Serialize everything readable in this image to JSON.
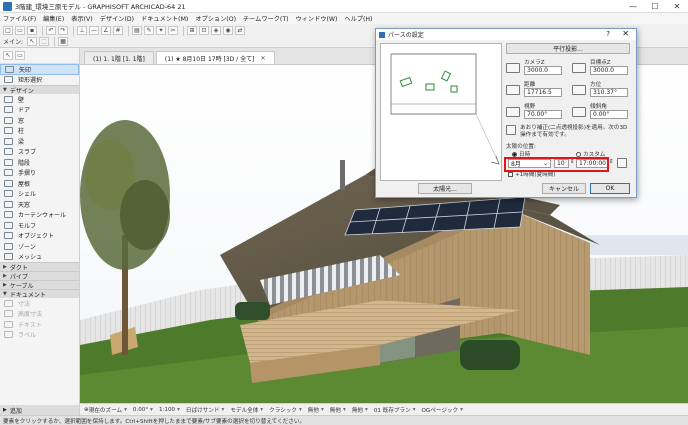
{
  "window": {
    "title": "3階建_環境三原モデル - GRAPHISOFT ARCHICAD-64 21",
    "controls": [
      "—",
      "☐",
      "✕"
    ]
  },
  "menu": [
    "ファイル(F)",
    "編集(E)",
    "表示(V)",
    "デザイン(D)",
    "ドキュメント(M)",
    "オプション(O)",
    "チームワーク(T)",
    "ウィンドウ(W)",
    "ヘルプ(H)"
  ],
  "toolbar": {
    "main_label": "メイン:"
  },
  "sidebar": {
    "tools": [
      {
        "label": "矢印",
        "selected": true
      },
      {
        "label": "矩形選択",
        "selected": false
      }
    ],
    "design_header": "デザイン",
    "design_items": [
      "壁",
      "ドア",
      "窓",
      "柱",
      "梁",
      "スラブ",
      "階段",
      "手摺り",
      "屋根",
      "シェル",
      "天窓",
      "カーテンウォール",
      "モルフ",
      "オブジェクト",
      "ゾーン",
      "メッシュ"
    ],
    "collapsed_headers": [
      "ダクト",
      "パイプ",
      "ケーブル"
    ],
    "document_header": "ドキュメント",
    "document_items": [
      "寸法",
      "高度寸法",
      "テキスト",
      "ラベル"
    ],
    "footer": "追加"
  },
  "tabs": [
    {
      "label": "(1) 1. 1階 [1. 1階]",
      "active": false
    },
    {
      "label": "(1) ★ 8月10日 17時 [3D / 全て]",
      "active": true
    }
  ],
  "dialog": {
    "title": "パースの設定",
    "help": "?",
    "close": "✕",
    "parallel_button": "平行投影...",
    "camera_z_label": "カメラZ",
    "camera_z": "3000.0",
    "target_z_label": "目標点Z",
    "target_z": "3000.0",
    "distance_label": "距離",
    "distance": "17716.5",
    "azimuth_label": "方位",
    "azimuth": "310.37°",
    "view_label": "視野",
    "view": "70.00°",
    "roll_label": "傾斜角",
    "roll": "0.00°",
    "perspective_note": "あおり補正(二点透視投影)を適用。次の3D操作まで有効です。",
    "sun_position_label": "太陽の位置:",
    "sun_option_date": "日時",
    "sun_option_custom": "カスタム",
    "month": "8月",
    "day": "10",
    "time": "17:00:00",
    "dst_label": "+1時間(夏時間)",
    "sun_button": "太陽光...",
    "cancel_button": "キャンセル",
    "ok_button": "OK"
  },
  "navbar": [
    {
      "label": "現在のズーム",
      "dropdown": true
    },
    {
      "label": "0.00°",
      "dropdown": true
    },
    {
      "label": "1:100",
      "dropdown": true
    },
    {
      "label": "日ばけサンド",
      "dropdown": true
    },
    {
      "label": "モデル全体",
      "dropdown": true
    },
    {
      "label": "クラシック",
      "dropdown": true
    },
    {
      "label": "無他",
      "dropdown": true
    },
    {
      "label": "無他",
      "dropdown": true
    },
    {
      "label": "無他",
      "dropdown": true
    },
    {
      "label": "01 既存プラン",
      "dropdown": true
    },
    {
      "label": "OGページック",
      "dropdown": true
    }
  ],
  "status": "要素をクリックするか、選択範囲を保持します。Ctrl+Shiftを押したままで要素/サブ要素の選択を切り替えてください。",
  "colors": {
    "highlight": "#e0161b",
    "sidebar_selected": "#cfe3f6",
    "sky": "#ffffff",
    "grass": "#4e7a2b"
  }
}
